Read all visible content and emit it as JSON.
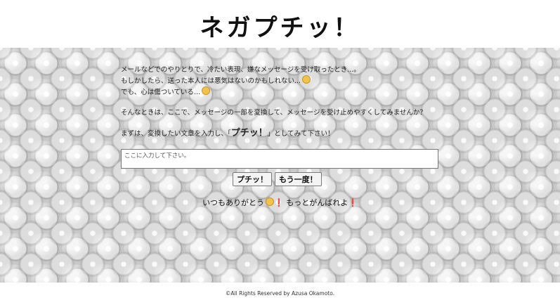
{
  "header": {
    "title": "ネガプチッ！"
  },
  "intro": {
    "line1": "メールなどでのやりとりで、冷たい表現、嫌なメッセージを受け取ったとき...。",
    "line2": "もしかしたら、送った本人には悪気はないのかもしれない...",
    "line2_emoji": "thinking-face",
    "line3": "でも、心は傷ついている...",
    "line3_emoji": "grimacing-face",
    "line4": "そんなときは、ここで、メッセージの一部を変換して、メッセージを受け止めやすくしてみませんか？",
    "line5_prefix": "まずは、変換したい文章を入力し、「",
    "line5_button": "プチッ！",
    "line5_suffix": "」としてみて下さい！"
  },
  "form": {
    "input_placeholder": "ここに入力して下さい。",
    "input_value": "",
    "submit_label": "プチッ！",
    "retry_label": "もう一度！"
  },
  "result": {
    "text_part1": "いつもありがとう",
    "emoji": "smiling-face",
    "exclaim1": "❗",
    "text_part2": " もっとがんばれよ",
    "exclaim2": "❗"
  },
  "footer": {
    "copyright": "©All Rights Reserved by Azusa Okamoto."
  },
  "colors": {
    "exclaim": "#d40000",
    "emoji": "#f2c14e"
  }
}
